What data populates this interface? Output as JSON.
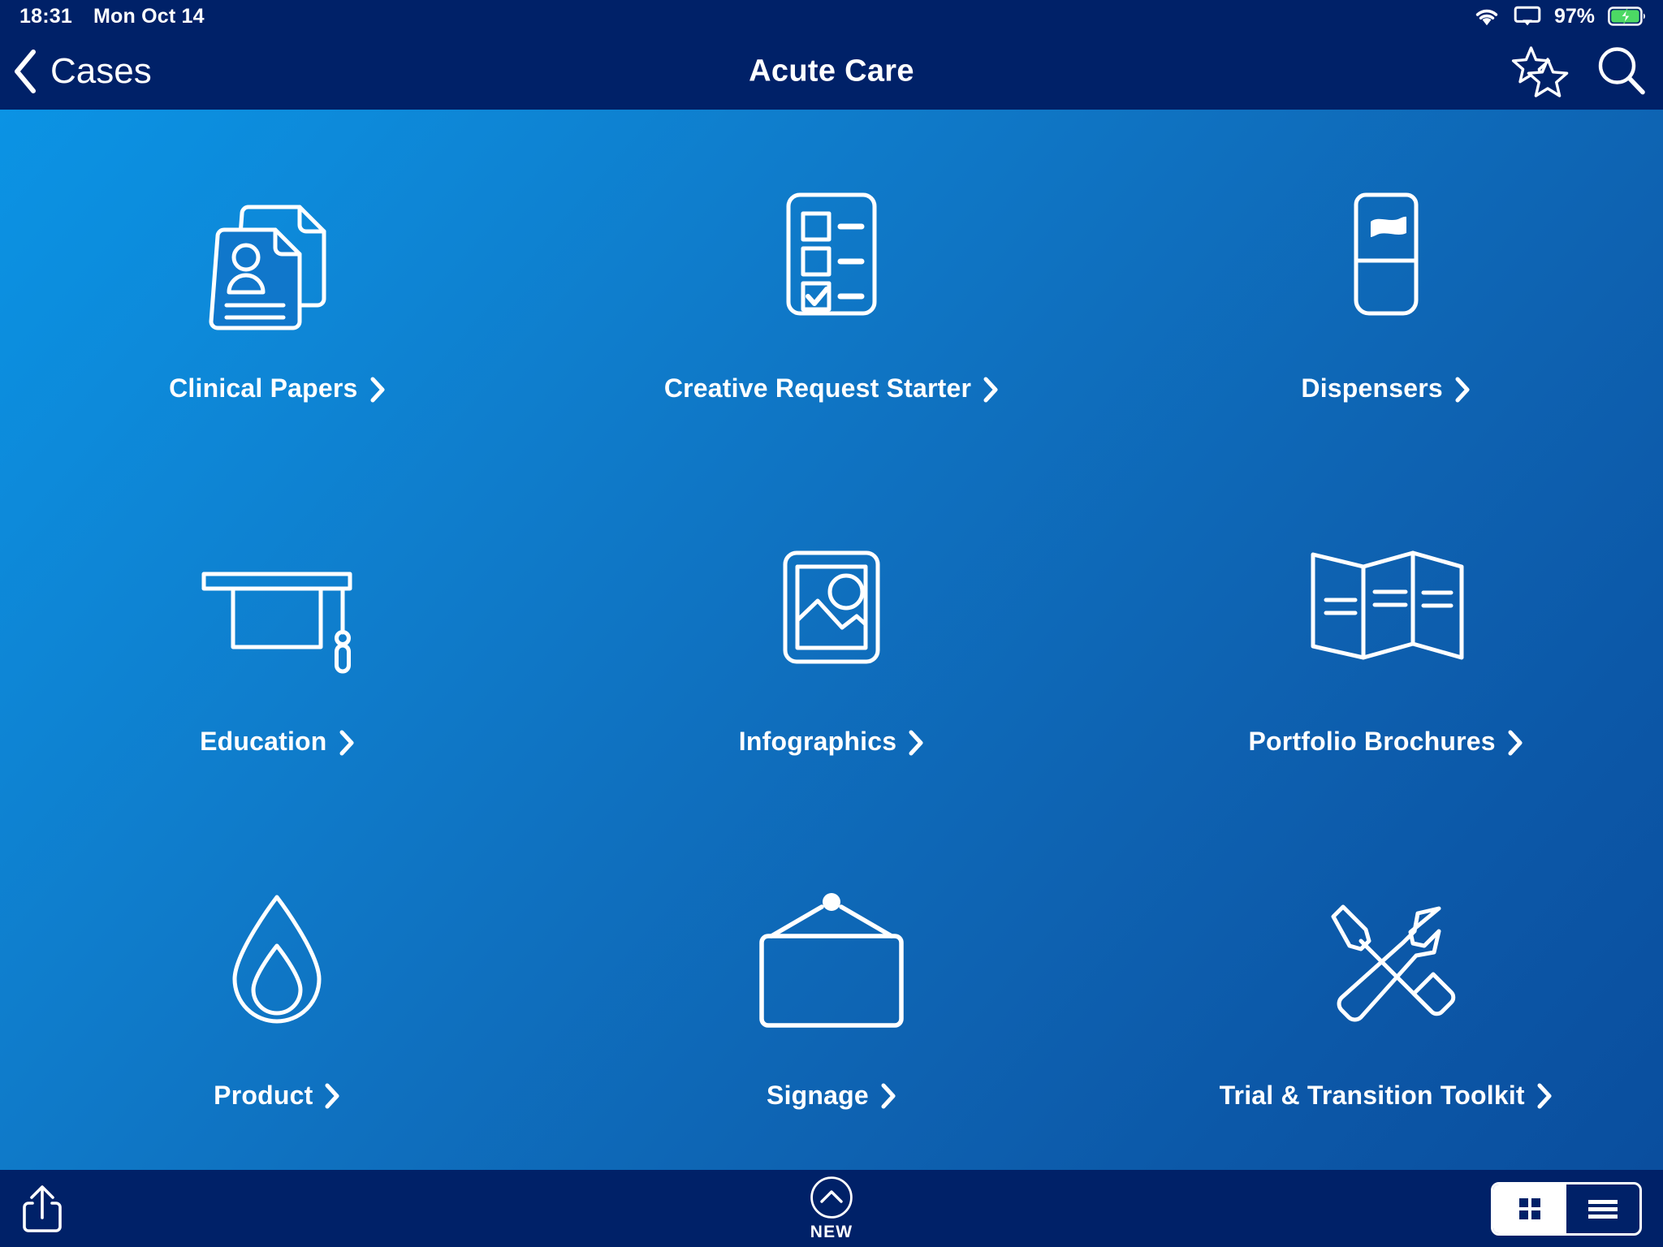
{
  "status_bar": {
    "time": "18:31",
    "date": "Mon Oct 14",
    "battery_percent": "97%",
    "icons": [
      "wifi-icon",
      "airplay-icon",
      "battery-charging-icon"
    ]
  },
  "nav_bar": {
    "back_label": "Cases",
    "back_icon": "chevron-left-icon",
    "title": "Acute Care",
    "actions": [
      {
        "name": "favorites-stars-icon",
        "label": "Favorites"
      },
      {
        "name": "search-icon",
        "label": "Search"
      }
    ]
  },
  "theme": {
    "navbar_bg": "#002168",
    "gradient_start": "#0b93e4",
    "gradient_end": "#0a4e9e",
    "accent_text": "#ffffff",
    "battery_green": "#4cd964"
  },
  "grid": {
    "columns": 3,
    "items": [
      {
        "label": "Clinical Papers",
        "icon": "documents-person-icon",
        "chevron": "chevron-right-icon"
      },
      {
        "label": "Creative Request Starter",
        "icon": "checklist-icon",
        "chevron": "chevron-right-icon"
      },
      {
        "label": "Dispensers",
        "icon": "dispenser-icon",
        "chevron": "chevron-right-icon"
      },
      {
        "label": "Education",
        "icon": "graduation-cap-icon",
        "chevron": "chevron-right-icon"
      },
      {
        "label": "Infographics",
        "icon": "image-photo-icon",
        "chevron": "chevron-right-icon"
      },
      {
        "label": "Portfolio Brochures",
        "icon": "trifold-brochure-icon",
        "chevron": "chevron-right-icon"
      },
      {
        "label": "Product",
        "icon": "water-droplet-icon",
        "chevron": "chevron-right-icon"
      },
      {
        "label": "Signage",
        "icon": "hanging-sign-icon",
        "chevron": "chevron-right-icon"
      },
      {
        "label": "Trial & Transition Toolkit",
        "icon": "tools-wrench-screwdriver-icon",
        "chevron": "chevron-right-icon"
      }
    ]
  },
  "toolbar": {
    "share_icon": "share-upload-icon",
    "new_button": {
      "label": "NEW",
      "icon": "chevron-up-circle-icon"
    },
    "view_toggle": {
      "selected": "grid",
      "options": [
        {
          "value": "grid",
          "icon": "grid-view-icon"
        },
        {
          "value": "list",
          "icon": "list-view-icon"
        }
      ]
    }
  }
}
